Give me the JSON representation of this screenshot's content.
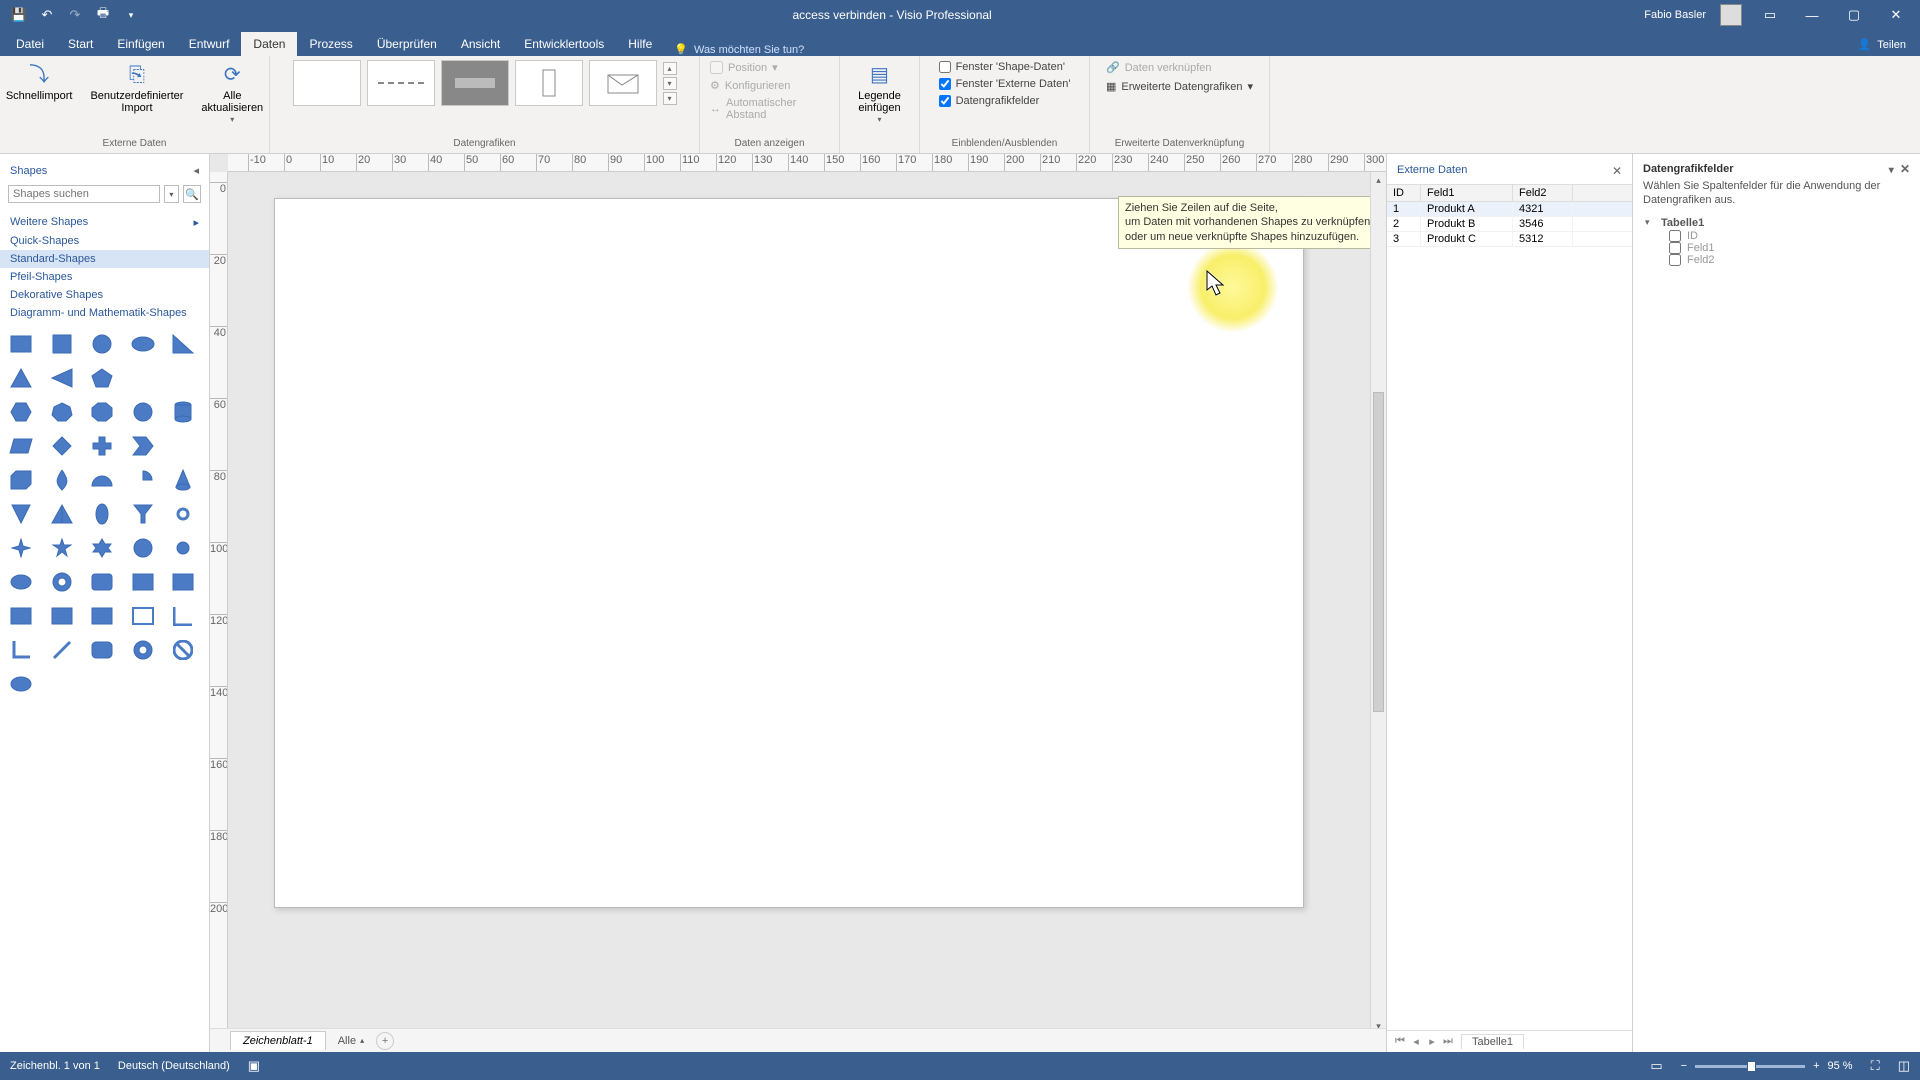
{
  "titlebar": {
    "doc_title": "access verbinden  -  Visio Professional",
    "user_name": "Fabio Basler"
  },
  "tabs": {
    "items": [
      "Datei",
      "Start",
      "Einfügen",
      "Entwurf",
      "Daten",
      "Prozess",
      "Überprüfen",
      "Ansicht",
      "Entwicklertools",
      "Hilfe"
    ],
    "active_index": 4,
    "tell_me": "Was möchten Sie tun?",
    "share": "Teilen"
  },
  "ribbon": {
    "g_extdata": {
      "label": "Externe Daten",
      "quick": "Schnellimport",
      "custom": "Benutzerdefinierter\nImport",
      "refresh": "Alle\naktualisieren"
    },
    "g_graphics": {
      "label": "Datengrafiken",
      "pos": "Position",
      "config": "Konfigurieren",
      "auto": "Automatischer Abstand",
      "legend": "Legende\neinfügen"
    },
    "g_show": {
      "label": "Daten anzeigen"
    },
    "g_toggle": {
      "label": "Einblenden/Ausblenden",
      "c1": "Fenster 'Shape-Daten'",
      "c2": "Fenster 'Externe Daten'",
      "c3": "Datengrafikfelder"
    },
    "g_adv": {
      "label": "Erweiterte Datenverknüpfung",
      "link": "Daten verknüpfen",
      "adv": "Erweiterte Datengrafiken"
    }
  },
  "shapes": {
    "title": "Shapes",
    "search_placeholder": "Shapes suchen",
    "cats": [
      "Weitere Shapes",
      "Quick-Shapes",
      "Standard-Shapes",
      "Pfeil-Shapes",
      "Dekorative Shapes",
      "Diagramm- und Mathematik-Shapes"
    ],
    "sel_index": 2
  },
  "tooltip": {
    "l1": "Ziehen Sie Zeilen auf die Seite,",
    "l2": "um Daten mit vorhandenen Shapes zu verknüpfen",
    "l3": "oder um neue verknüpfte Shapes hinzuzufügen."
  },
  "extdata": {
    "title": "Externe Daten",
    "headers": [
      "ID",
      "Feld1",
      "Feld2"
    ],
    "rows": [
      {
        "id": "1",
        "f1": "Produkt A",
        "f2": "4321",
        "sel": true
      },
      {
        "id": "2",
        "f1": "Produkt B",
        "f2": "3546",
        "sel": false
      },
      {
        "id": "3",
        "f1": "Produkt C",
        "f2": "5312",
        "sel": false
      }
    ],
    "tab_name": "Tabelle1"
  },
  "fields": {
    "title": "Datengrafikfelder",
    "hint": "Wählen Sie Spaltenfelder für die Anwendung der Datengrafiken aus.",
    "table": "Tabelle1",
    "cols": [
      "ID",
      "Feld1",
      "Feld2"
    ]
  },
  "pagetabs": {
    "sheet": "Zeichenblatt-1",
    "all": "Alle"
  },
  "status": {
    "page": "Zeichenbl. 1 von 1",
    "lang": "Deutsch (Deutschland)",
    "zoom": "95 %"
  },
  "ruler_h": [
    -10,
    0,
    10,
    20,
    30,
    40,
    50,
    60,
    70,
    80,
    90,
    100,
    110,
    120,
    130,
    140,
    150,
    160,
    170,
    180,
    190,
    200,
    210,
    220,
    230,
    240,
    250,
    260,
    270,
    280,
    290,
    300
  ],
  "ruler_v": [
    0,
    20,
    40,
    60,
    80,
    100,
    120,
    140,
    160,
    180,
    200
  ]
}
